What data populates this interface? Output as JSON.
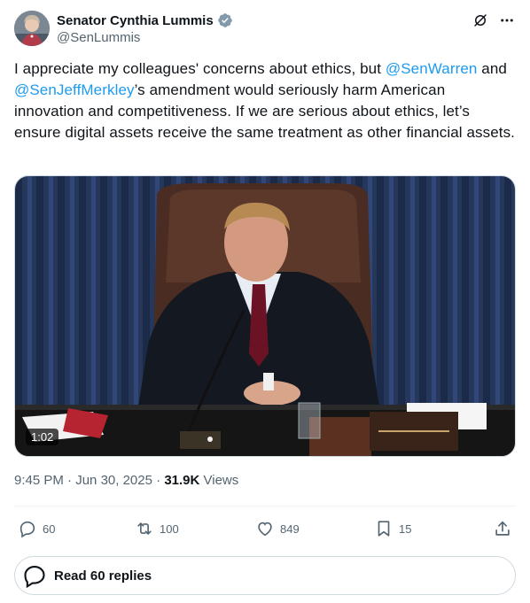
{
  "author": {
    "display_name": "Senator Cynthia Lummis",
    "handle": "@SenLummis",
    "verified": true,
    "verified_badge_color": "#829aab"
  },
  "header_icons": [
    "grok-icon",
    "more-options-icon"
  ],
  "tweet": {
    "text_part1": "I appreciate my colleagues' concerns about ethics, but ",
    "mention1": "@SenWarren",
    "text_part2": " and ",
    "mention2": "@SenJeffMerkley",
    "text_part3": "’s amendment would seriously harm American innovation and competitiveness. If we are serious about ethics, let’s ensure digital assets receive the same treatment as other financial assets."
  },
  "media": {
    "type": "video",
    "duration": "1:02"
  },
  "meta": {
    "time": "9:45 PM",
    "date": "Jun 30, 2025",
    "views_count": "31.9K",
    "views_label": "Views"
  },
  "actions": {
    "replies": "60",
    "reposts": "100",
    "likes": "849",
    "bookmarks": "15"
  },
  "read_replies_label": "Read 60 replies",
  "colors": {
    "link": "#1d9bf0",
    "text_primary": "#0f1419",
    "text_secondary": "#536471",
    "border": "#cfd9de"
  }
}
